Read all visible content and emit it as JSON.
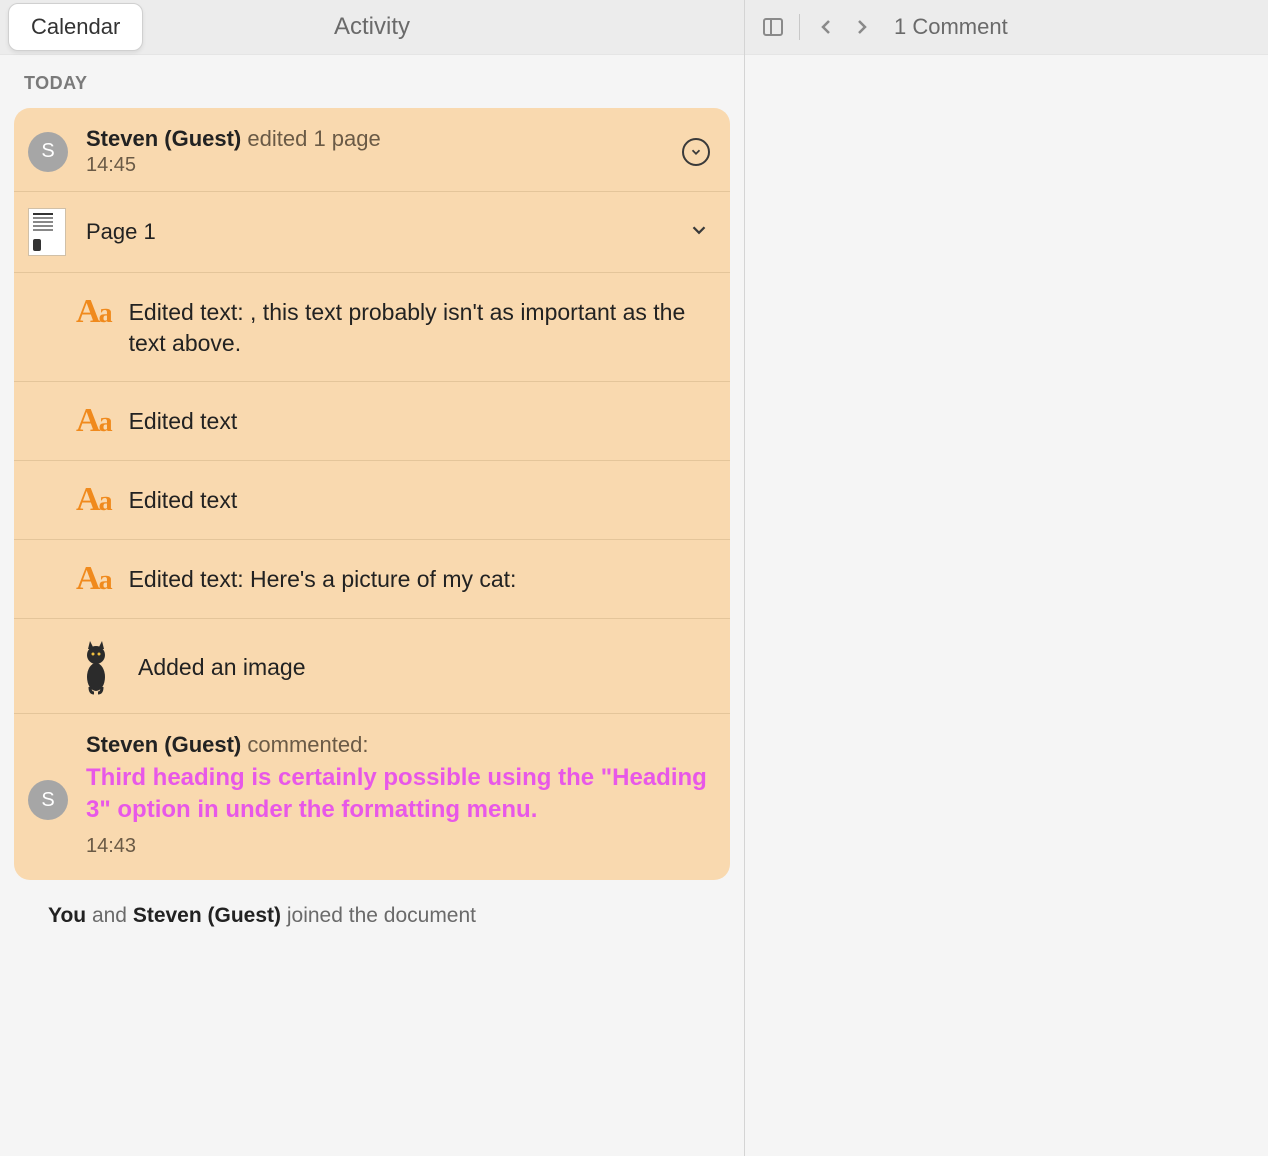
{
  "tabs": {
    "calendar": "Calendar",
    "activity": "Activity"
  },
  "section": {
    "today": "TODAY"
  },
  "activity": {
    "author": "Steven (Guest)",
    "action": "edited 1 page",
    "time": "14:45",
    "page_label": "Page 1",
    "changes": [
      "Edited text: , this text probably isn't as important as the text above.",
      "Edited text",
      "Edited text",
      "Edited text: Here's a picture of my cat:"
    ],
    "image_added": "Added an image",
    "comment": {
      "author": "Steven (Guest)",
      "said": "commented:",
      "text": "Third heading is certainly possible using the \"Heading 3\" option in under the formatting menu.",
      "time": "14:43"
    }
  },
  "joined": {
    "you": "You",
    "and": " and ",
    "other": "Steven (Guest)",
    "rest": " joined the document"
  },
  "right": {
    "comment_count": "1 Comment"
  },
  "avatar_initial": "S"
}
